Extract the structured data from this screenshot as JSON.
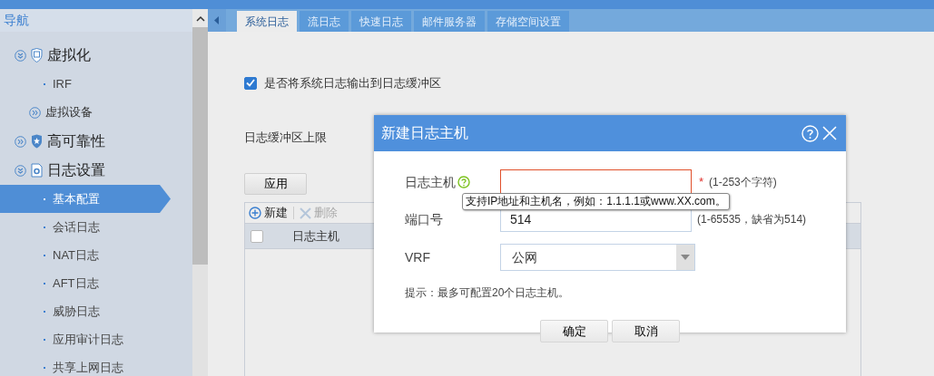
{
  "sidebar": {
    "title": "导航",
    "items": [
      {
        "label": "虚拟化",
        "expanded": true,
        "children": [
          {
            "kind": "page",
            "label": "IRF",
            "selected": false
          },
          {
            "kind": "group",
            "label": "虚拟设备",
            "expanded": false
          }
        ]
      },
      {
        "label": "高可靠性",
        "expanded": false
      },
      {
        "label": "日志设置",
        "expanded": true,
        "children": [
          {
            "kind": "page",
            "label": "基本配置",
            "selected": true
          },
          {
            "kind": "page",
            "label": "会话日志",
            "selected": false
          },
          {
            "kind": "page",
            "label": "NAT日志",
            "selected": false
          },
          {
            "kind": "page",
            "label": "AFT日志",
            "selected": false
          },
          {
            "kind": "page",
            "label": "威胁日志",
            "selected": false
          },
          {
            "kind": "page",
            "label": "应用审计日志",
            "selected": false
          },
          {
            "kind": "page",
            "label": "共享上网日志",
            "selected": false
          }
        ]
      }
    ]
  },
  "tabs": [
    {
      "label": "系统日志",
      "selected": true
    },
    {
      "label": "流日志",
      "selected": false
    },
    {
      "label": "快速日志",
      "selected": false
    },
    {
      "label": "邮件服务器",
      "selected": false
    },
    {
      "label": "存储空间设置",
      "selected": false
    }
  ],
  "main": {
    "buffer_output": {
      "label": "是否将系统日志输出到日志缓冲区",
      "checked": true
    },
    "buffer_limit_label": "日志缓冲区上限",
    "apply_button": "应用",
    "toolbar": [
      {
        "kind": "add",
        "label": "新建",
        "disabled": false
      },
      {
        "kind": "delete",
        "label": "删除",
        "disabled": true
      }
    ],
    "table": {
      "select_all_checked": false,
      "columns": [
        "日志主机"
      ]
    }
  },
  "dialog": {
    "title": "新建日志主机",
    "fields": [
      {
        "kind": "text",
        "label": "日志主机",
        "help": true,
        "invalid": true,
        "required_mark": "*",
        "hint": "(1-253个字符)"
      },
      {
        "kind": "text",
        "label": "端口号",
        "value": "514",
        "hint": "(1-65535，缺省为514)"
      },
      {
        "kind": "select",
        "label": "VRF",
        "value": "公网"
      }
    ],
    "tooltip": "支持IP地址和主机名，例如：1.1.1.1或www.XX.com。",
    "note": "提示：最多可配置20个日志主机。",
    "buttons": [
      "确定",
      "取消"
    ]
  }
}
